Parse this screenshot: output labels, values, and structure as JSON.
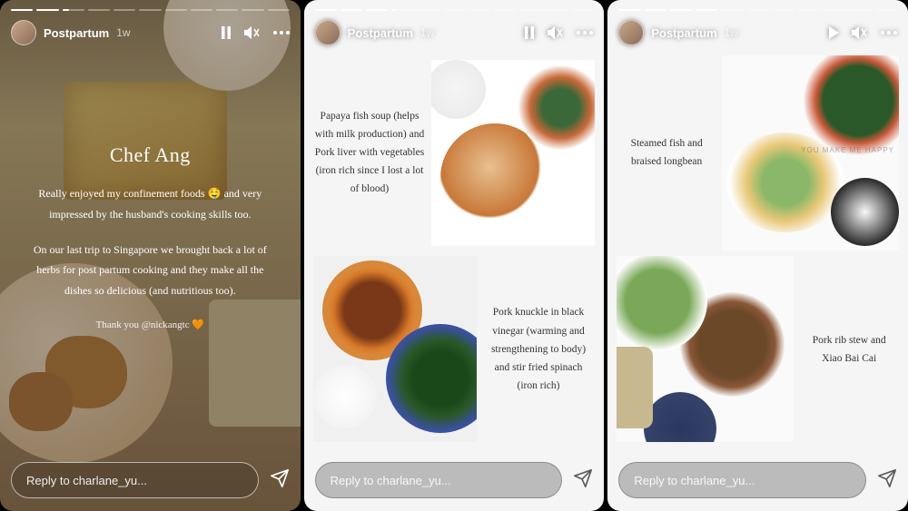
{
  "story1": {
    "highlight_name": "Postpartum",
    "ago": "1w",
    "heading": "Chef Ang",
    "p1": "Really enjoyed my confinement foods 🤤 and very impressed by the husband's cooking skills too.",
    "p2": "On our last trip to Singapore we brought back a lot of herbs for post partum cooking and they make all the dishes so delicious (and nutritious too).",
    "thankyou": "Thank you @nickangtc 🧡",
    "reply_placeholder": "Reply to charlane_yu...",
    "progress_fill_pct": 32
  },
  "story2": {
    "highlight_name": "Postpartum",
    "ago": "1w",
    "caption1": "Papaya fish soup (helps with milk production) and Pork liver with vegetables (iron rich since I lost a lot of blood)",
    "caption2": "Pork knuckle in black vinegar (warming and strengthening to body) and stir fried spinach (iron rich)",
    "reply_placeholder": "Reply to charlane_yu...",
    "progress_fill_pct": 18
  },
  "story3": {
    "highlight_name": "Postpartum",
    "ago": "1w",
    "caption1": "Steamed fish and braised longbean",
    "caption2": "Pork rib stew and Xiao Bai Cai",
    "reply_placeholder": "Reply to charlane_yu...",
    "progress_fill_pct": 0,
    "watermark": "YOU MAKE ME HAPPY"
  }
}
